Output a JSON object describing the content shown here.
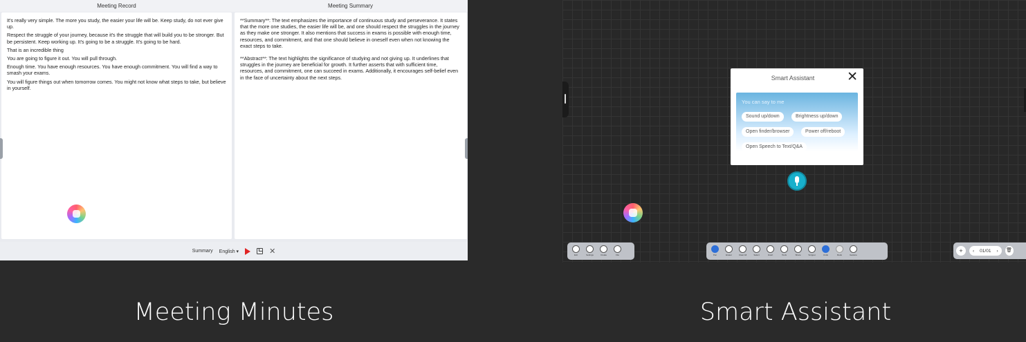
{
  "meeting": {
    "record_header": "Meeting Record",
    "summary_header": "Meeting Summary",
    "record_paragraphs": [
      "It's really very simple. The more you study, the easier your life will be. Keep study, do not ever give up.",
      "Respect the struggle of your journey, because it's the struggle that will build you to be stronger. But be persistent. Keep working up. It's going to be a struggle. It's going to be hard.",
      "That is an incredible thing",
      "You are going to figure it out. You will pull through.",
      "Enough time. You have enough resources. You have enough commitment. You will find a way to smash your exams.",
      "You will figure things out when tomorrow comes. You might not know what steps to take, but believe in yourself."
    ],
    "summary_paragraphs": [
      "**Summary**: The text emphasizes the importance of continuous study and perseverance. It states that the more one studies, the easier life will be, and one should respect the struggles in the journey as they make one stronger. It also mentions that success in exams is possible with enough time, resources, and commitment, and that one should believe in oneself even when not knowing the exact steps to take.",
      "**Abstract**: The text highlights the significance of studying and not giving up. It underlines that struggles in the journey are beneficial for growth. It further asserts that with sufficient time, resources, and commitment, one can succeed in exams. Additionally, it encourages self-belief even in the face of uncertainty about the next steps."
    ],
    "bottom_bar": {
      "summary_label": "Summary",
      "language_label": "English ▾",
      "close_label": "✕"
    },
    "caption": "Meeting Minutes"
  },
  "assistant": {
    "title": "Smart Assistant",
    "close_label": "✕",
    "prompt": "You can say to me",
    "chips": [
      "Sound up/down",
      "Brightness up/down",
      "Open finder/browser",
      "Power off/reboot",
      "Open Speech to Text/Q&A"
    ],
    "caption": "Smart Assistant"
  },
  "whiteboard": {
    "left_tools": [
      "Exit",
      "Settings",
      "Create",
      "File"
    ],
    "main_tools": [
      "Pen",
      "Eraser",
      "Clear All",
      "Select",
      "Insert",
      "Tools",
      "Share",
      "Snippet",
      "Undo",
      "Redo",
      "Gesture"
    ],
    "pager": {
      "add_label": "+",
      "prev_label": "‹",
      "page_label": "01/01",
      "next_label": "›",
      "delete_label": "🗑"
    }
  }
}
